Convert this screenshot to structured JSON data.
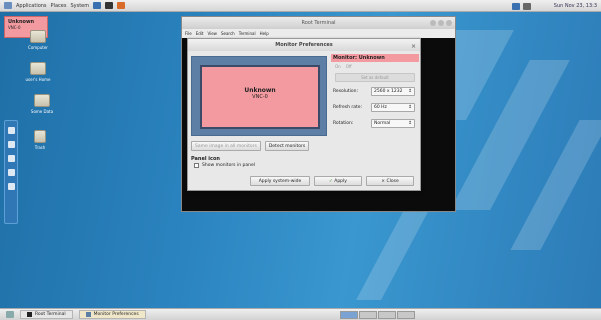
{
  "top_panel": {
    "menus": [
      "Applications",
      "Places",
      "System"
    ],
    "clock": "Sun Nov 23, 13:3"
  },
  "notification": {
    "title": "Unknown",
    "subtitle": "VNC-0"
  },
  "desktop_icons": [
    {
      "label": "Computer"
    },
    {
      "label": "user's Home"
    },
    {
      "label": "Some Data"
    },
    {
      "label": "Trash"
    }
  ],
  "terminal": {
    "title": "Root Terminal",
    "menus": [
      "File",
      "Edit",
      "View",
      "Search",
      "Terminal",
      "Help"
    ]
  },
  "monitor_prefs": {
    "title": "Monitor Preferences",
    "monitor": {
      "name": "Unknown",
      "connector": "VNC-0"
    },
    "header": "Monitor: Unknown",
    "radio_on": "On",
    "radio_off": "Off",
    "set_default_label": "Set as default",
    "resolution": {
      "label": "Resolution:",
      "value": "2560 x 1232"
    },
    "refresh_rate": {
      "label": "Refresh rate:",
      "value": "60 Hz"
    },
    "rotation": {
      "label": "Rotation:",
      "value": "Normal"
    },
    "same_image_label": "Same image in all monitors",
    "detect_label": "Detect monitors",
    "panel_icon_heading": "Panel icon",
    "show_in_panel_label": "Show monitors in panel",
    "apply_system_wide_label": "Apply system-wide",
    "apply_label": "Apply",
    "close_label": "Close"
  },
  "bottom_panel": {
    "tasks": [
      "Root Terminal",
      "Monitor Preferences"
    ]
  },
  "colors": {
    "accent_pink": "#f39aa0",
    "desktop_blue": "#2b84c0"
  }
}
